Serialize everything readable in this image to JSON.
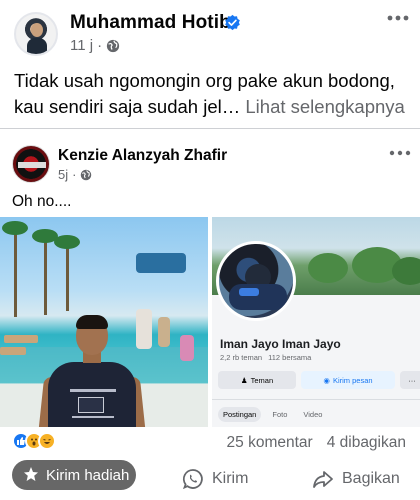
{
  "post": {
    "author": "Muhammad Hotib",
    "time": "11 j",
    "text": "Tidak usah ngomongin org pake akun bodong, kau sendiri saja sudah jel…",
    "see_more": "Lihat selengkapnya"
  },
  "shared": {
    "author": "Kenzie Alanzyah Zhafir",
    "time": "5j",
    "text": "Oh no...."
  },
  "profile_shot": {
    "name": "Iman Jayo Iman Jayo",
    "stat_friends": "2,2 rb teman",
    "stat_mutual": "112 bersama",
    "btn_friends": "Teman",
    "btn_message": "Kirim pesan",
    "btn_more": "···",
    "tab_posts": "Postingan",
    "tab_photos": "Foto",
    "tab_video": "Video"
  },
  "stats": {
    "comments": "25 komentar",
    "shares": "4 dibagikan"
  },
  "actions": {
    "gift": "Kirim hadiah",
    "send": "Kirim",
    "share": "Bagikan"
  },
  "colors": {
    "accent": "#1877f2",
    "text_secondary": "#65676b",
    "divider": "#ced0d4"
  },
  "icons": [
    "verified-badge-icon",
    "globe-icon",
    "more-options-icon",
    "like-reaction-icon",
    "wow-reaction-icon",
    "haha-reaction-icon",
    "gift-icon",
    "whatsapp-icon",
    "share-arrow-icon"
  ]
}
